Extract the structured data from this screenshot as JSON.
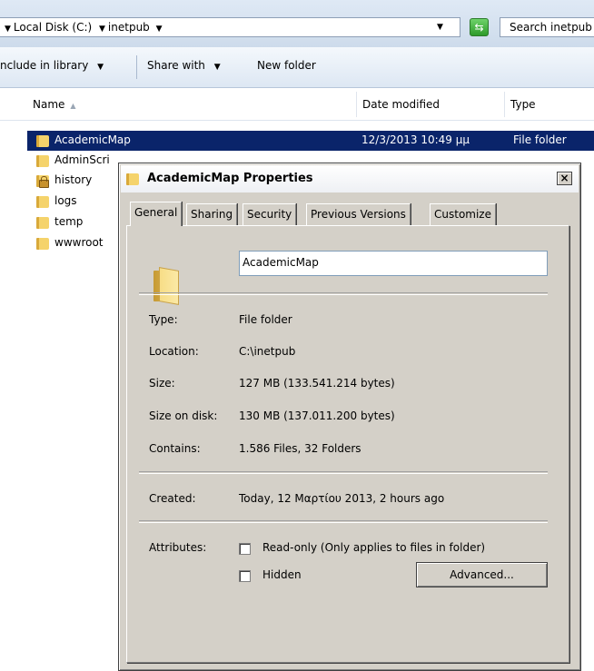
{
  "explorer": {
    "breadcrumbs": [
      "Local Disk (C:)",
      "inetpub"
    ],
    "search_placeholder": "Search inetpub",
    "toolbar": {
      "include_in_library": "nclude in library",
      "share_with": "Share with",
      "new_folder": "New folder"
    },
    "columns": {
      "name": "Name",
      "date_modified": "Date modified",
      "type": "Type"
    },
    "files": [
      {
        "name": "AcademicMap",
        "date": "12/3/2013 10:49 μμ",
        "type": "File folder",
        "icon": "folder-icon",
        "selected": true
      },
      {
        "name": "AdminScri",
        "icon": "folder-icon"
      },
      {
        "name": "history",
        "icon": "locked-folder-icon"
      },
      {
        "name": "logs",
        "icon": "folder-icon"
      },
      {
        "name": "temp",
        "icon": "folder-icon"
      },
      {
        "name": "wwwroot",
        "icon": "folder-icon"
      }
    ]
  },
  "dialog": {
    "title": "AcademicMap Properties",
    "close_glyph": "×",
    "tabs": [
      "General",
      "Sharing",
      "Security",
      "Previous Versions",
      "Customize"
    ],
    "active_tab": "General",
    "folder_name": "AcademicMap",
    "labels": {
      "type": "Type:",
      "location": "Location:",
      "size": "Size:",
      "size_on_disk": "Size on disk:",
      "contains": "Contains:",
      "created": "Created:",
      "attributes": "Attributes:"
    },
    "values": {
      "type": "File folder",
      "location": "C:\\inetpub",
      "size": "127 MB (133.541.214 bytes)",
      "size_on_disk": "130 MB (137.011.200 bytes)",
      "contains": "1.586 Files, 32 Folders",
      "created": "Today, 12 Μαρτίου 2013, 2 hours ago"
    },
    "attributes": {
      "read_only": "Read-only (Only applies to files in folder)",
      "hidden": "Hidden",
      "read_only_checked": false,
      "hidden_checked": false
    },
    "advanced_button": "Advanced..."
  },
  "colors": {
    "selection": "#0a246a",
    "dialog_face": "#d4d0c8",
    "chrome": "#dde7f3"
  }
}
